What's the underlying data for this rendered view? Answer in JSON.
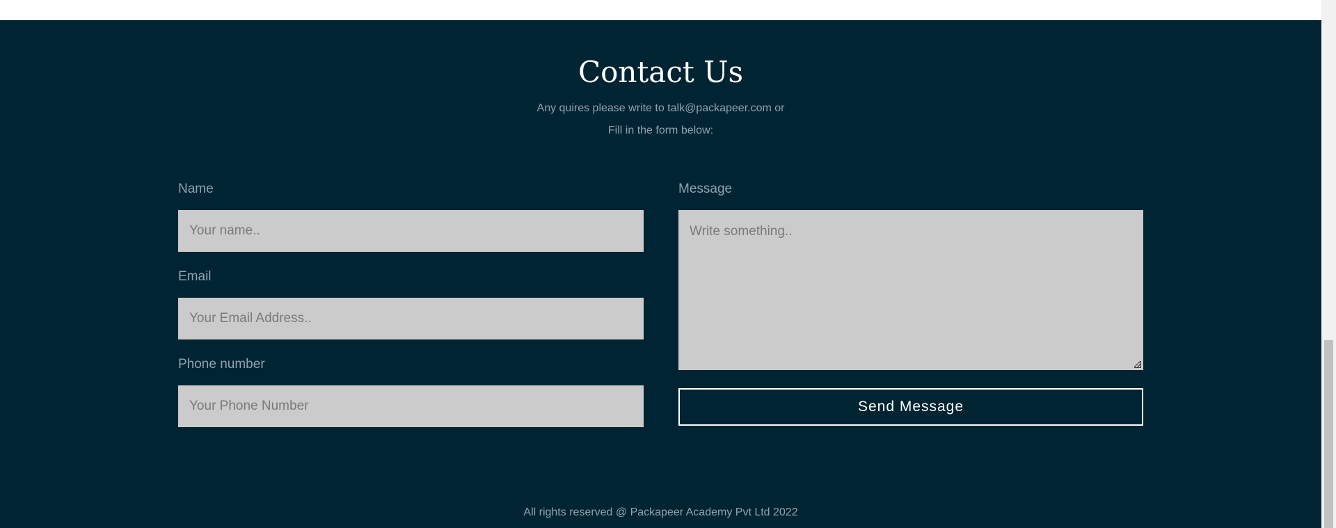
{
  "section": {
    "title": "Contact Us",
    "subtitle_line1": "Any quires please write to talk@packapeer.com or",
    "subtitle_line2": "Fill in the form below:"
  },
  "form": {
    "name_label": "Name",
    "name_placeholder": "Your name..",
    "email_label": "Email",
    "email_placeholder": "Your Email Address..",
    "phone_label": "Phone number",
    "phone_placeholder": "Your Phone Number",
    "message_label": "Message",
    "message_placeholder": "Write something..",
    "submit_label": "Send Message"
  },
  "footer": {
    "copyright": "All rights reserved @ Packapeer Academy Pvt Ltd 2022"
  },
  "colors": {
    "background": "#012432",
    "field": "#cbcbcb",
    "text_muted": "#8fa3b0"
  }
}
